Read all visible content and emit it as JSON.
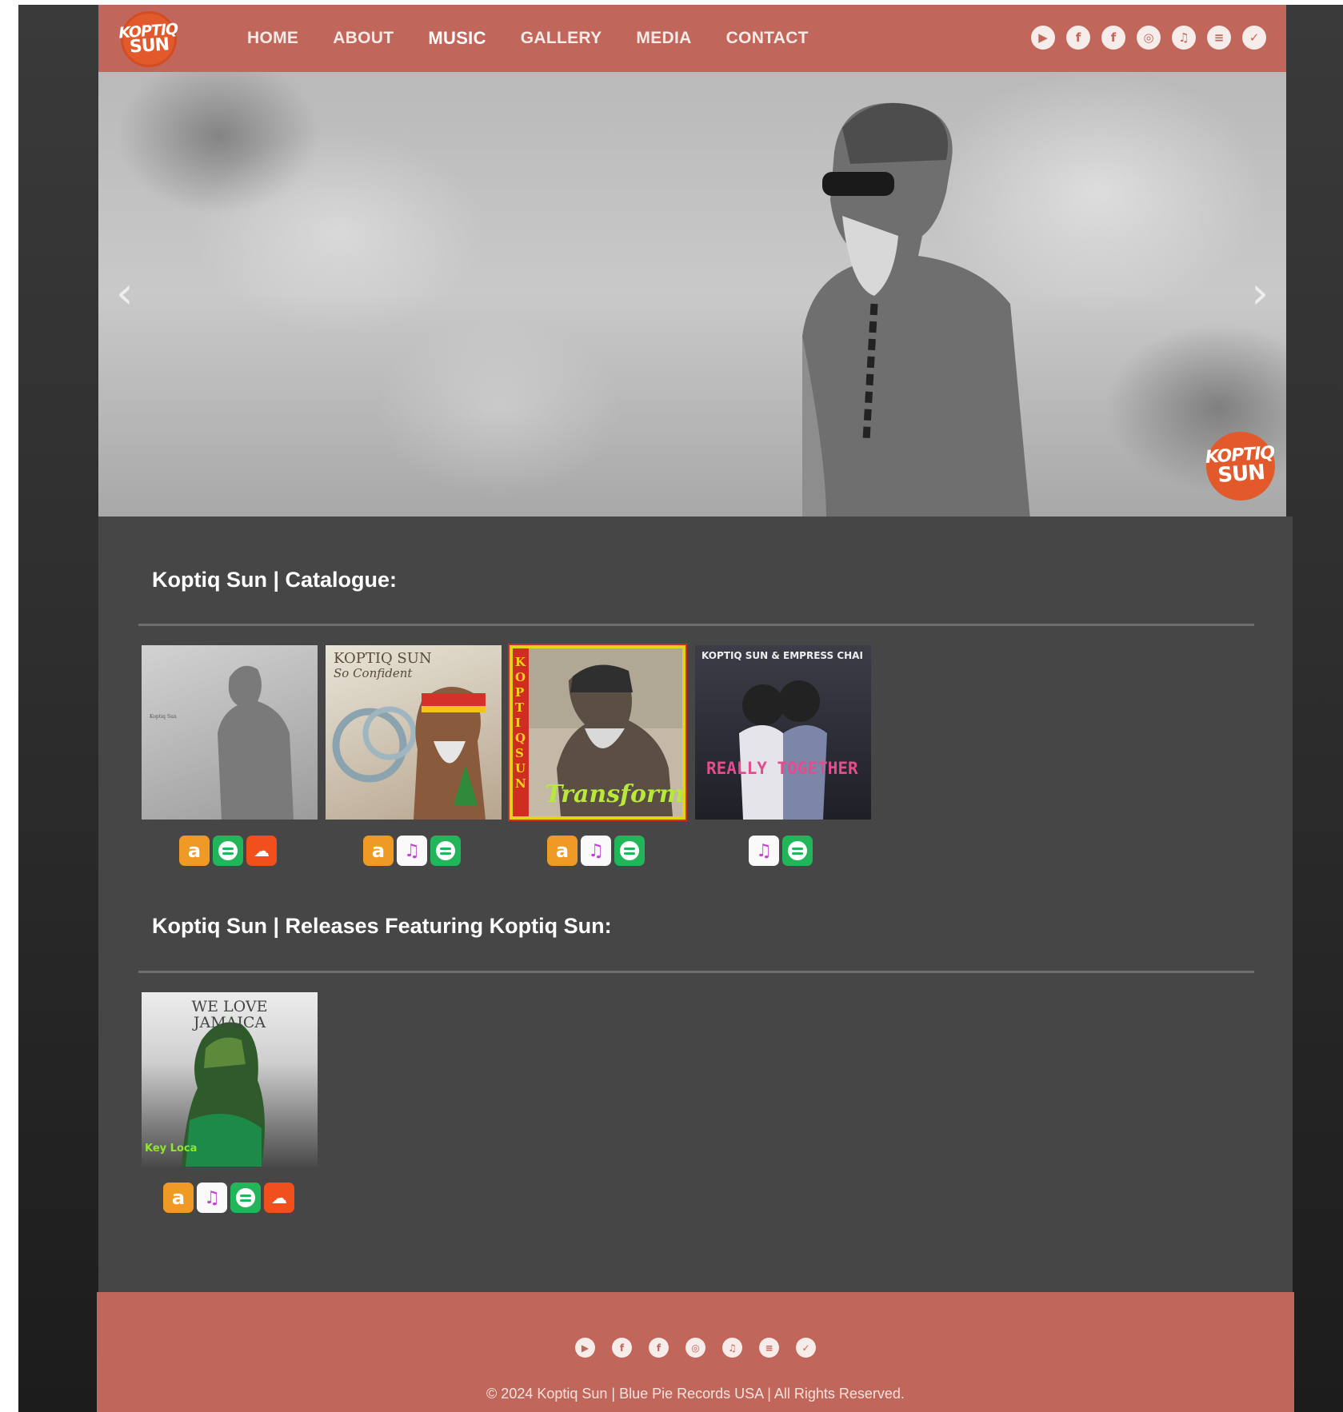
{
  "logo": {
    "line1": "KOPTIQ",
    "line2": "SUN"
  },
  "nav": [
    {
      "label": "HOME",
      "active": false
    },
    {
      "label": "ABOUT",
      "active": false
    },
    {
      "label": "MUSIC",
      "active": true
    },
    {
      "label": "GALLERY",
      "active": false
    },
    {
      "label": "MEDIA",
      "active": false
    },
    {
      "label": "CONTACT",
      "active": false
    }
  ],
  "social_icons": [
    "youtube-icon",
    "facebook-icon",
    "facebook-alt-icon",
    "instagram-icon",
    "apple-music-icon",
    "spotify-icon",
    "twitter-icon"
  ],
  "hero": {
    "prev_glyph": "‹",
    "next_glyph": "›",
    "badge_line1": "KOPTIQ",
    "badge_line2": "SUN"
  },
  "catalogue": {
    "title": "Koptiq Sun | Catalogue:",
    "items": [
      {
        "cover_text": "Koptiq Sun",
        "stores": [
          "amazon",
          "spotify",
          "soundcloud"
        ]
      },
      {
        "cover_text": "KOPTIQ SUN",
        "cover_subtext": "So Confident",
        "stores": [
          "amazon",
          "apple",
          "spotify"
        ]
      },
      {
        "cover_text": "KOPTIQ SUN",
        "cover_subtext": "Transformed",
        "stores": [
          "amazon",
          "apple",
          "spotify"
        ]
      },
      {
        "cover_text": "KOPTIQ SUN & EMPRESS CHAI",
        "cover_subtext": "REALLY TOGETHER",
        "stores": [
          "apple",
          "spotify"
        ]
      }
    ]
  },
  "featuring": {
    "title": "Koptiq Sun | Releases Featuring Koptiq Sun:",
    "items": [
      {
        "cover_text": "WE LOVE JAMAICA",
        "cover_subtext": "Key Loca",
        "stores": [
          "amazon",
          "apple",
          "spotify",
          "soundcloud"
        ]
      }
    ]
  },
  "store_glyphs": {
    "amazon": "a",
    "apple": "♫",
    "soundcloud": "☁"
  },
  "footer": {
    "copyright": "© 2024 Koptiq Sun | Blue Pie Records USA | All Rights Reserved."
  },
  "colors": {
    "brand": "#c1665a",
    "logo": "#e25a2c",
    "content_bg": "#464646"
  }
}
